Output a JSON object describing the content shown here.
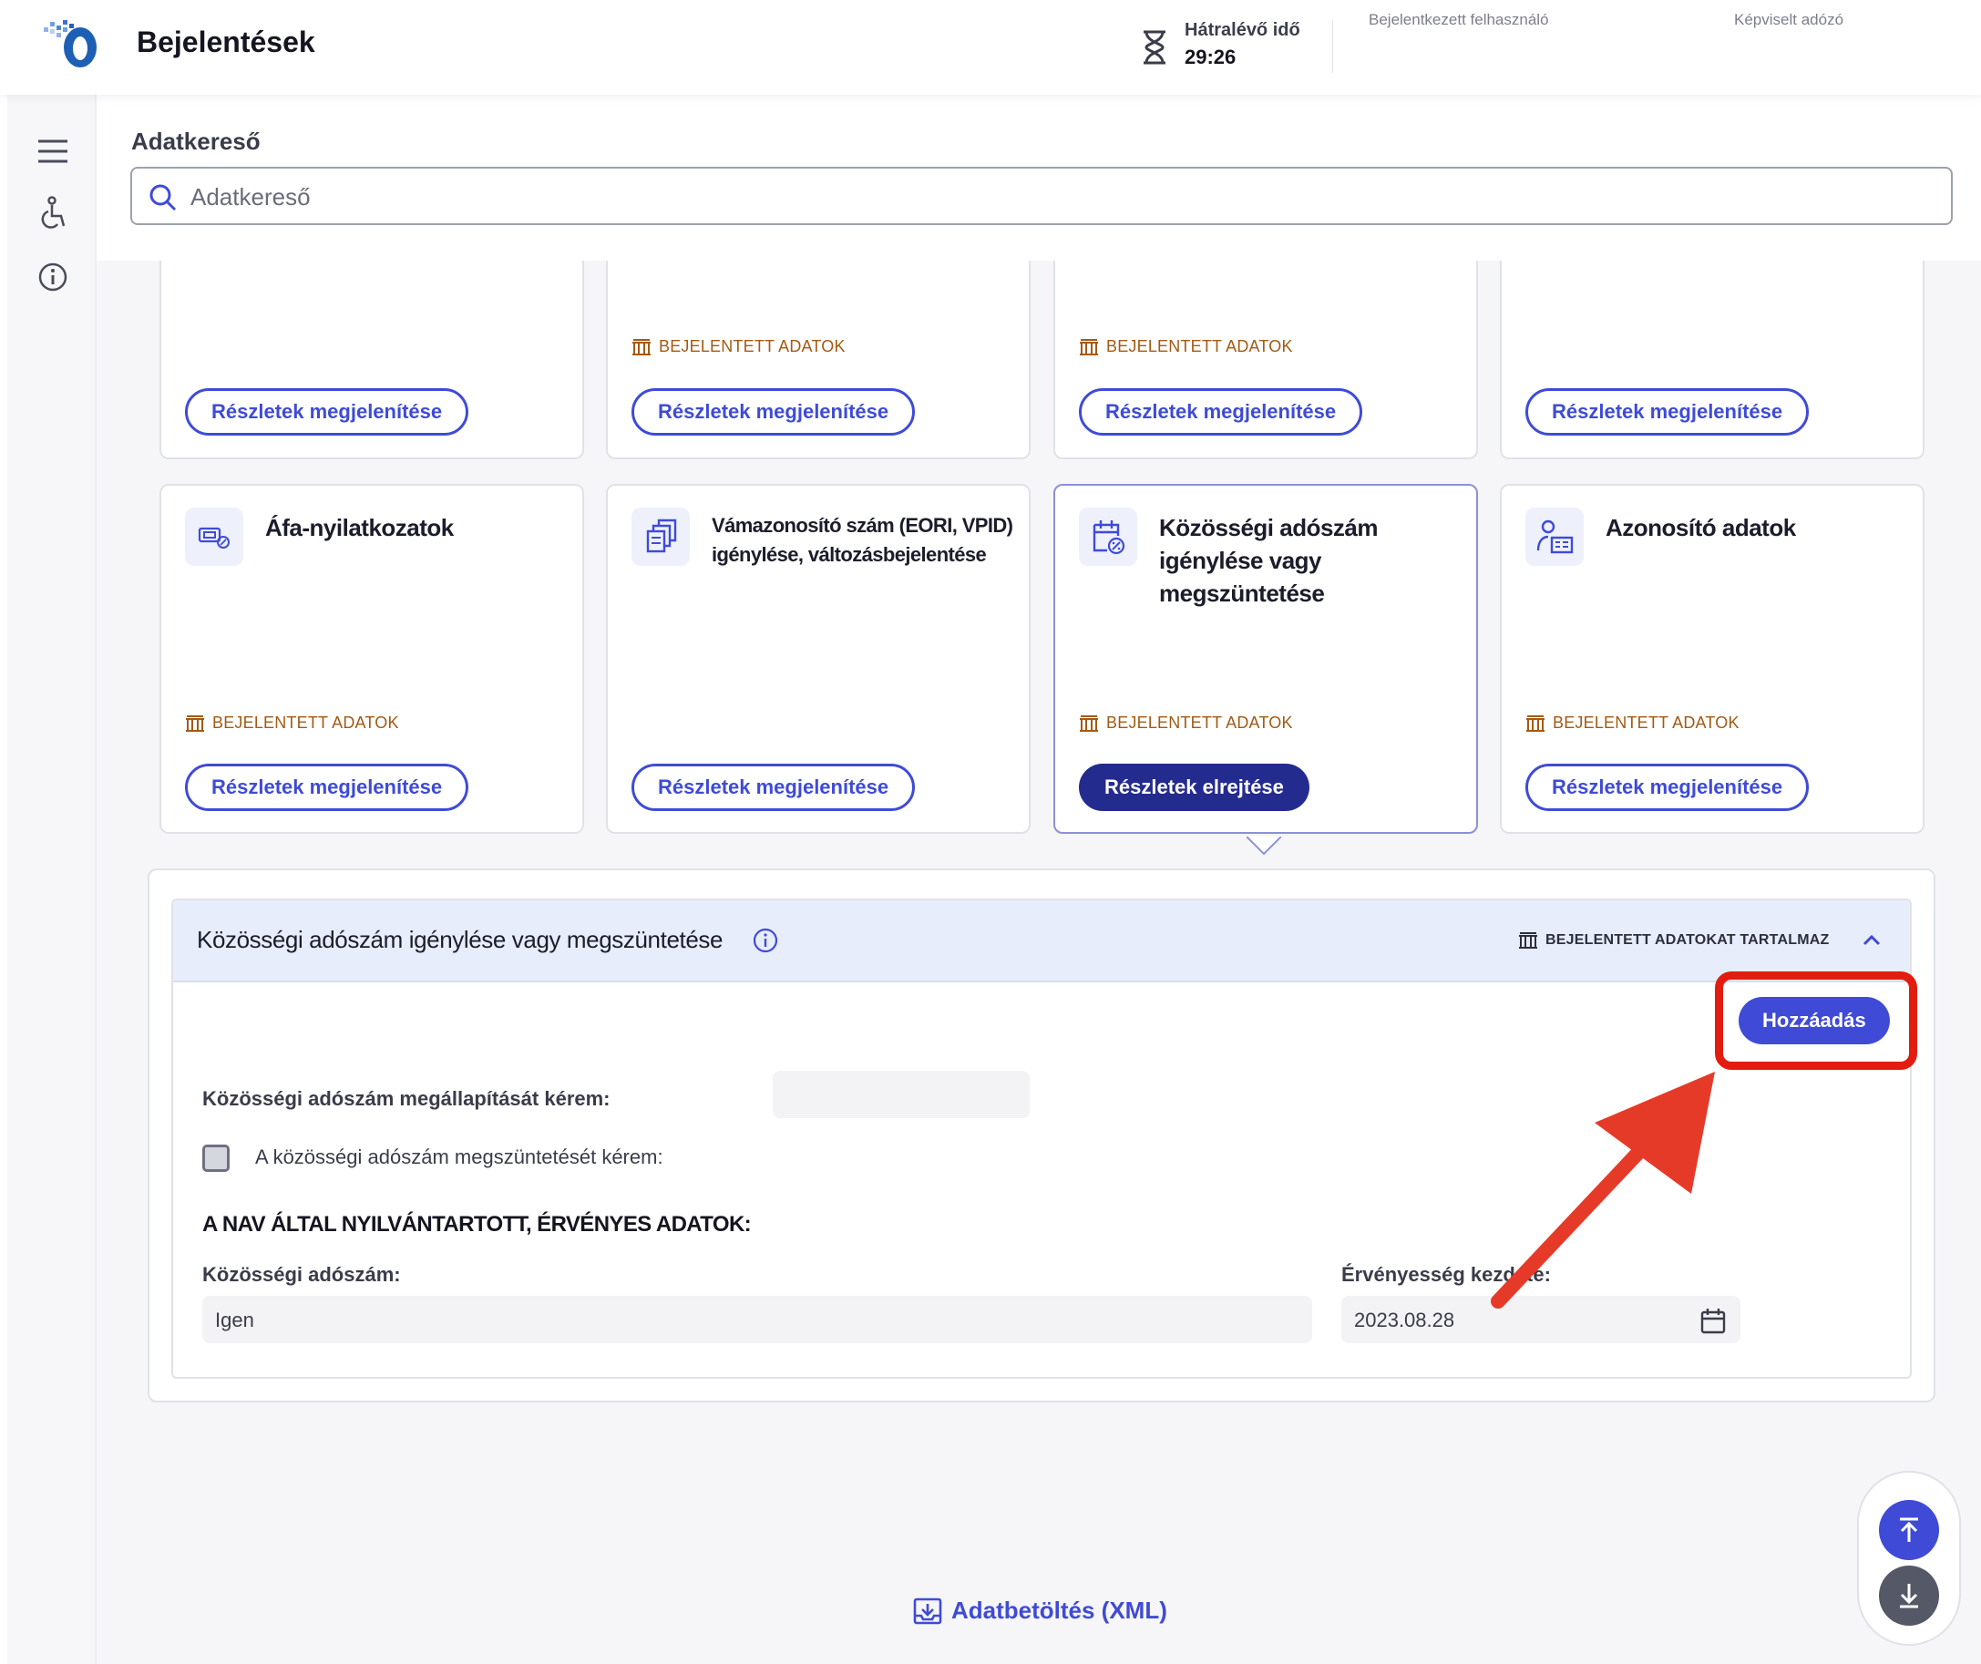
{
  "header": {
    "app_title": "Bejelentések",
    "timer_label": "Hátralévő idő",
    "timer_value": "29:26",
    "logged_in_user_label": "Bejelentkezett felhasználó",
    "represented_taxpayer_label": "Képviselt adózó"
  },
  "sidebar": {
    "icons": [
      "menu-icon",
      "accessibility-icon",
      "info-icon"
    ]
  },
  "search": {
    "title": "Adatkereső",
    "placeholder": "Adatkereső"
  },
  "cards_top": [
    {
      "has_badge": false,
      "button": "Részletek megjelenítése"
    },
    {
      "has_badge": true,
      "badge": "BEJELENTETT ADATOK",
      "button": "Részletek megjelenítése"
    },
    {
      "has_badge": true,
      "badge": "BEJELENTETT ADATOK",
      "button": "Részletek megjelenítése"
    },
    {
      "has_badge": false,
      "button": "Részletek megjelenítése"
    }
  ],
  "cards_bottom": [
    {
      "title": "Áfa-nyilatkozatok",
      "badge": "BEJELENTETT ADATOK",
      "button": "Részletek megjelenítése",
      "icon": "vat-icon"
    },
    {
      "title": "Vámazonosító szám (EORI, VPID) igénylése, változásbejelentése",
      "button": "Részletek megjelenítése",
      "icon": "documents-icon"
    },
    {
      "title": "Közösségi adószám igénylése vagy megszüntetése",
      "badge": "BEJELENTETT ADATOK",
      "button": "Részletek elrejtése",
      "icon": "calendar-percent-icon",
      "active": true
    },
    {
      "title": "Azonosító adatok",
      "badge": "BEJELENTETT ADATOK",
      "button": "Részletek megjelenítése",
      "icon": "id-card-icon"
    }
  ],
  "detail": {
    "title": "Közösségi adószám igénylése vagy megszüntetése",
    "badge": "BEJELENTETT ADATOKAT TARTALMAZ",
    "add_button": "Hozzáadás",
    "request_label": "Közösségi adószám megállapítását kérem:",
    "request_value": "",
    "terminate_label": "A közösségi adószám megszüntetését kérem:",
    "terminate_checked": false,
    "section_title": "A NAV ÁLTAL NYILVÁNTARTOTT, ÉRVÉNYES ADATOK:",
    "vat_number_label": "Közösségi adószám:",
    "vat_number_value": "Igen",
    "validity_label": "Érvényesség kezdete:",
    "validity_value": "2023.08.28"
  },
  "footer": {
    "xml_link": "Adatbetöltés (XML)"
  },
  "colors": {
    "primary": "#3f4bd6",
    "dark_primary": "#242b8f",
    "badge_brown": "#a35a14",
    "annotation_red": "#e21d0f",
    "detail_header": "#e8edfb"
  }
}
